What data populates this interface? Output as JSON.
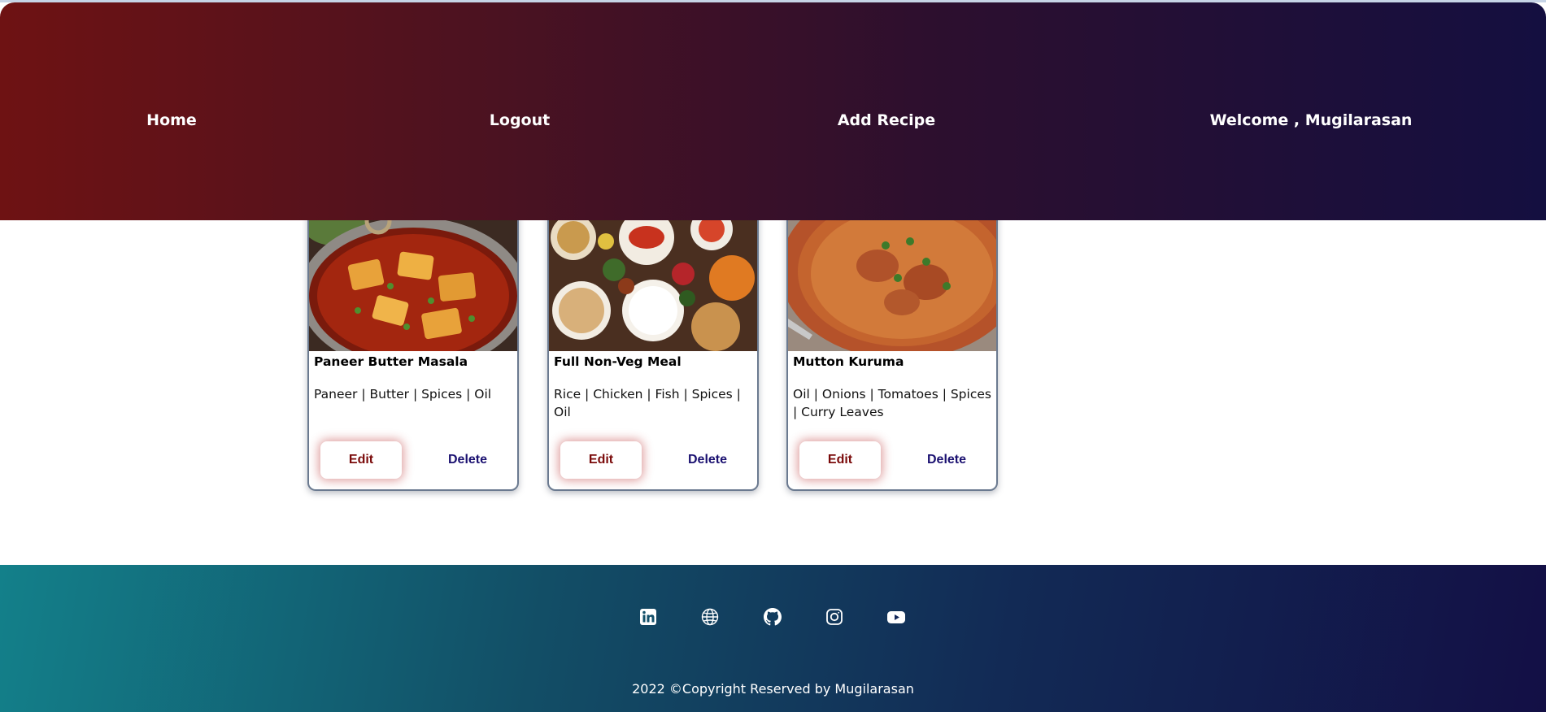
{
  "nav": {
    "home": "Home",
    "logout": "Logout",
    "add_recipe": "Add Recipe",
    "welcome": "Welcome , Mugilarasan"
  },
  "recipes": [
    {
      "title": "Paneer Butter Masala",
      "ingredients": "Paneer | Butter | Spices | Oil",
      "edit_label": "Edit",
      "delete_label": "Delete"
    },
    {
      "title": "Full Non-Veg Meal",
      "ingredients": "Rice | Chicken | Fish | Spices | Oil",
      "edit_label": "Edit",
      "delete_label": "Delete"
    },
    {
      "title": "Mutton Kuruma",
      "ingredients": "Oil | Onions | Tomatoes | Spices | Curry Leaves",
      "edit_label": "Edit",
      "delete_label": "Delete"
    }
  ],
  "footer": {
    "social_icons": [
      "linkedin-icon",
      "globe-icon",
      "github-icon",
      "instagram-icon",
      "youtube-icon"
    ],
    "copyright": "2022 ©Copyright Reserved by Mugilarasan"
  },
  "colors": {
    "header_gradient_start": "#6e1213",
    "header_gradient_end": "#140f40",
    "footer_gradient_start": "#13808a",
    "footer_gradient_end": "#130f45",
    "edit_text": "#7a0a0a",
    "delete_text": "#1a1070"
  }
}
